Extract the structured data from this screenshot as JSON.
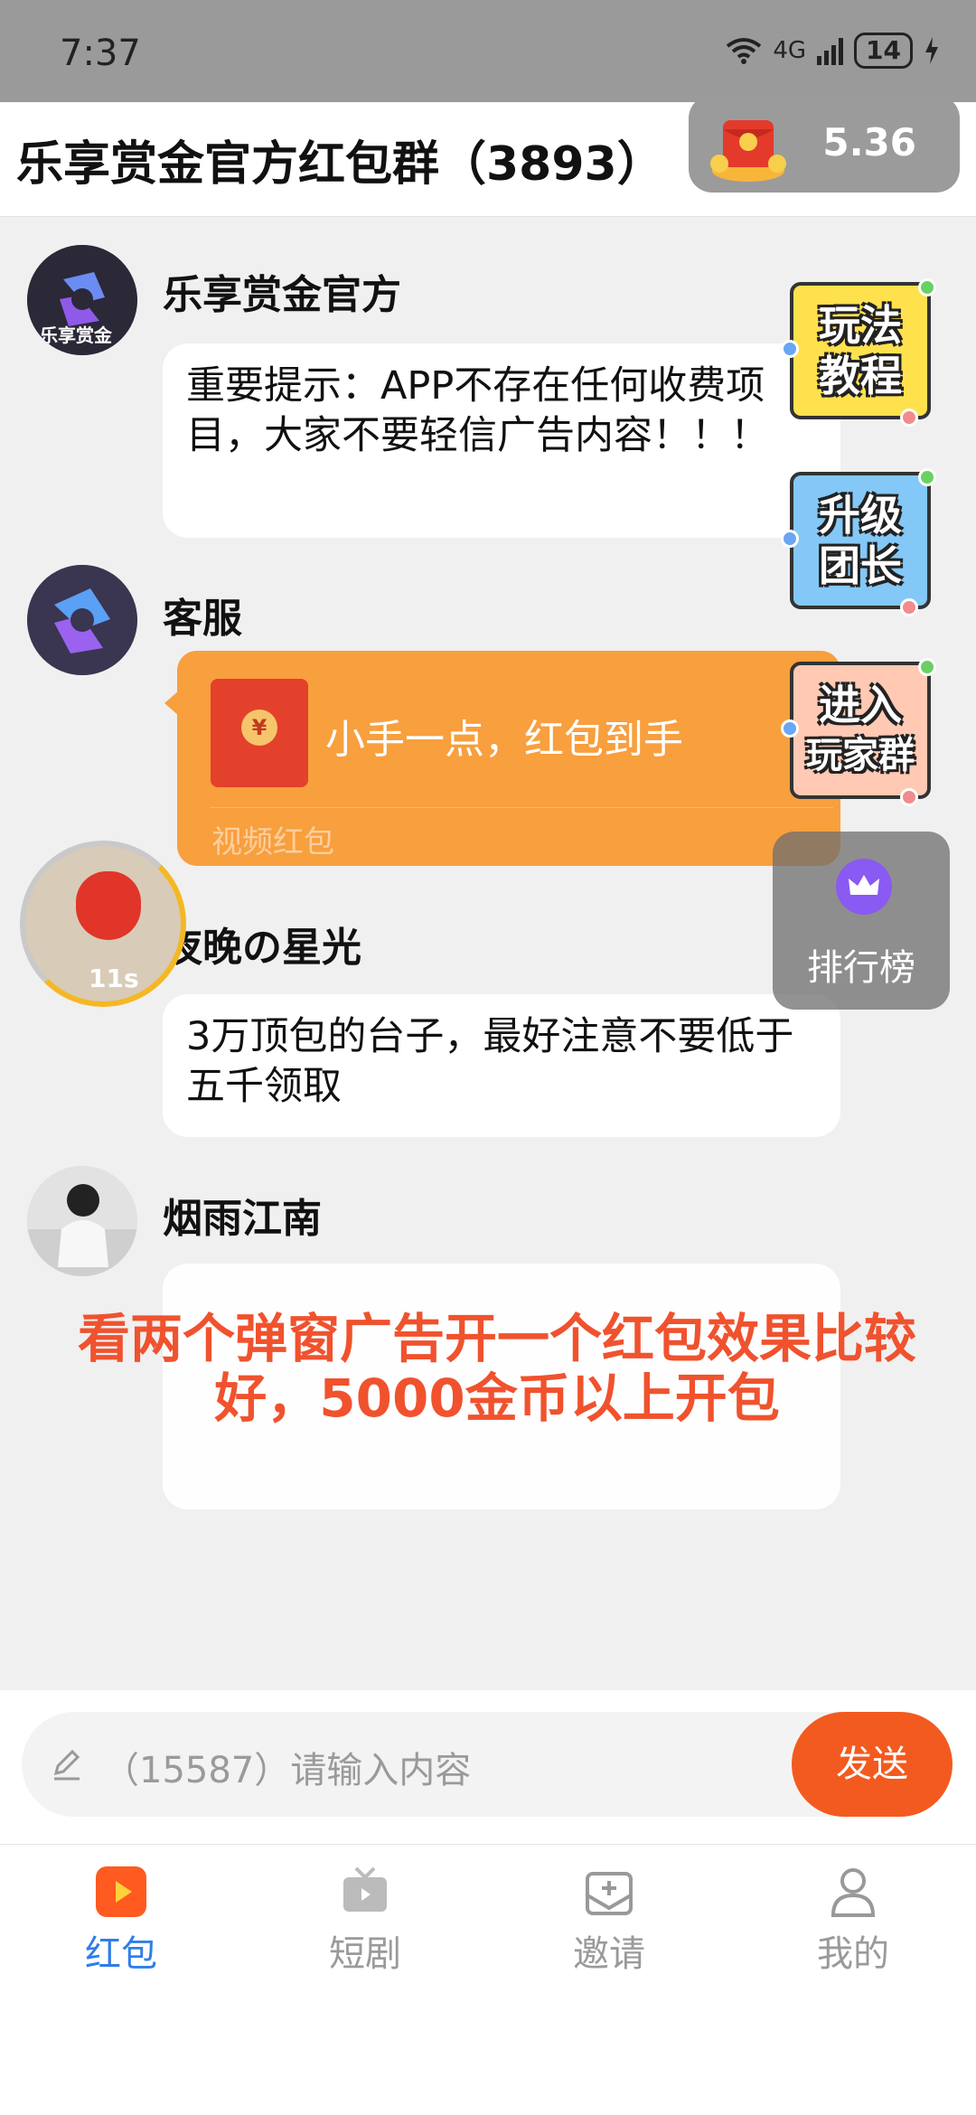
{
  "status_bar": {
    "time": "7:37",
    "network": "4G",
    "battery": "14"
  },
  "header": {
    "title": "乐享赏金官方红包群（3893）",
    "balance": "5.36"
  },
  "messages": [
    {
      "sender": "乐享赏金官方",
      "avatar_text": "乐享赏金",
      "text": "重要提示：APP不存在任何收费项目，大家不要轻信广告内容！！！"
    },
    {
      "sender": "客服",
      "promo_title": "小手一点，红包到手",
      "promo_footer": "视频红包"
    },
    {
      "sender": "夜晚の星光",
      "text": "3万顶包的台子，最好注意不要低于五千领取"
    },
    {
      "sender": "烟雨江南",
      "text": ""
    }
  ],
  "side_badges": [
    {
      "line1": "玩法",
      "line2": "教程"
    },
    {
      "line1": "升级",
      "line2": "团长"
    },
    {
      "line1": "进入",
      "line2": "玩家群"
    }
  ],
  "ranking": {
    "label": "排行榜"
  },
  "timer": {
    "text": "11s"
  },
  "overlay": {
    "text": "看两个弹窗广告开一个红包效果比较好，5000金币以上开包"
  },
  "input": {
    "placeholder": "（15587）请输入内容",
    "send_label": "发送"
  },
  "nav": [
    {
      "label": "红包",
      "active": true
    },
    {
      "label": "短剧",
      "active": false
    },
    {
      "label": "邀请",
      "active": false
    },
    {
      "label": "我的",
      "active": false
    }
  ]
}
